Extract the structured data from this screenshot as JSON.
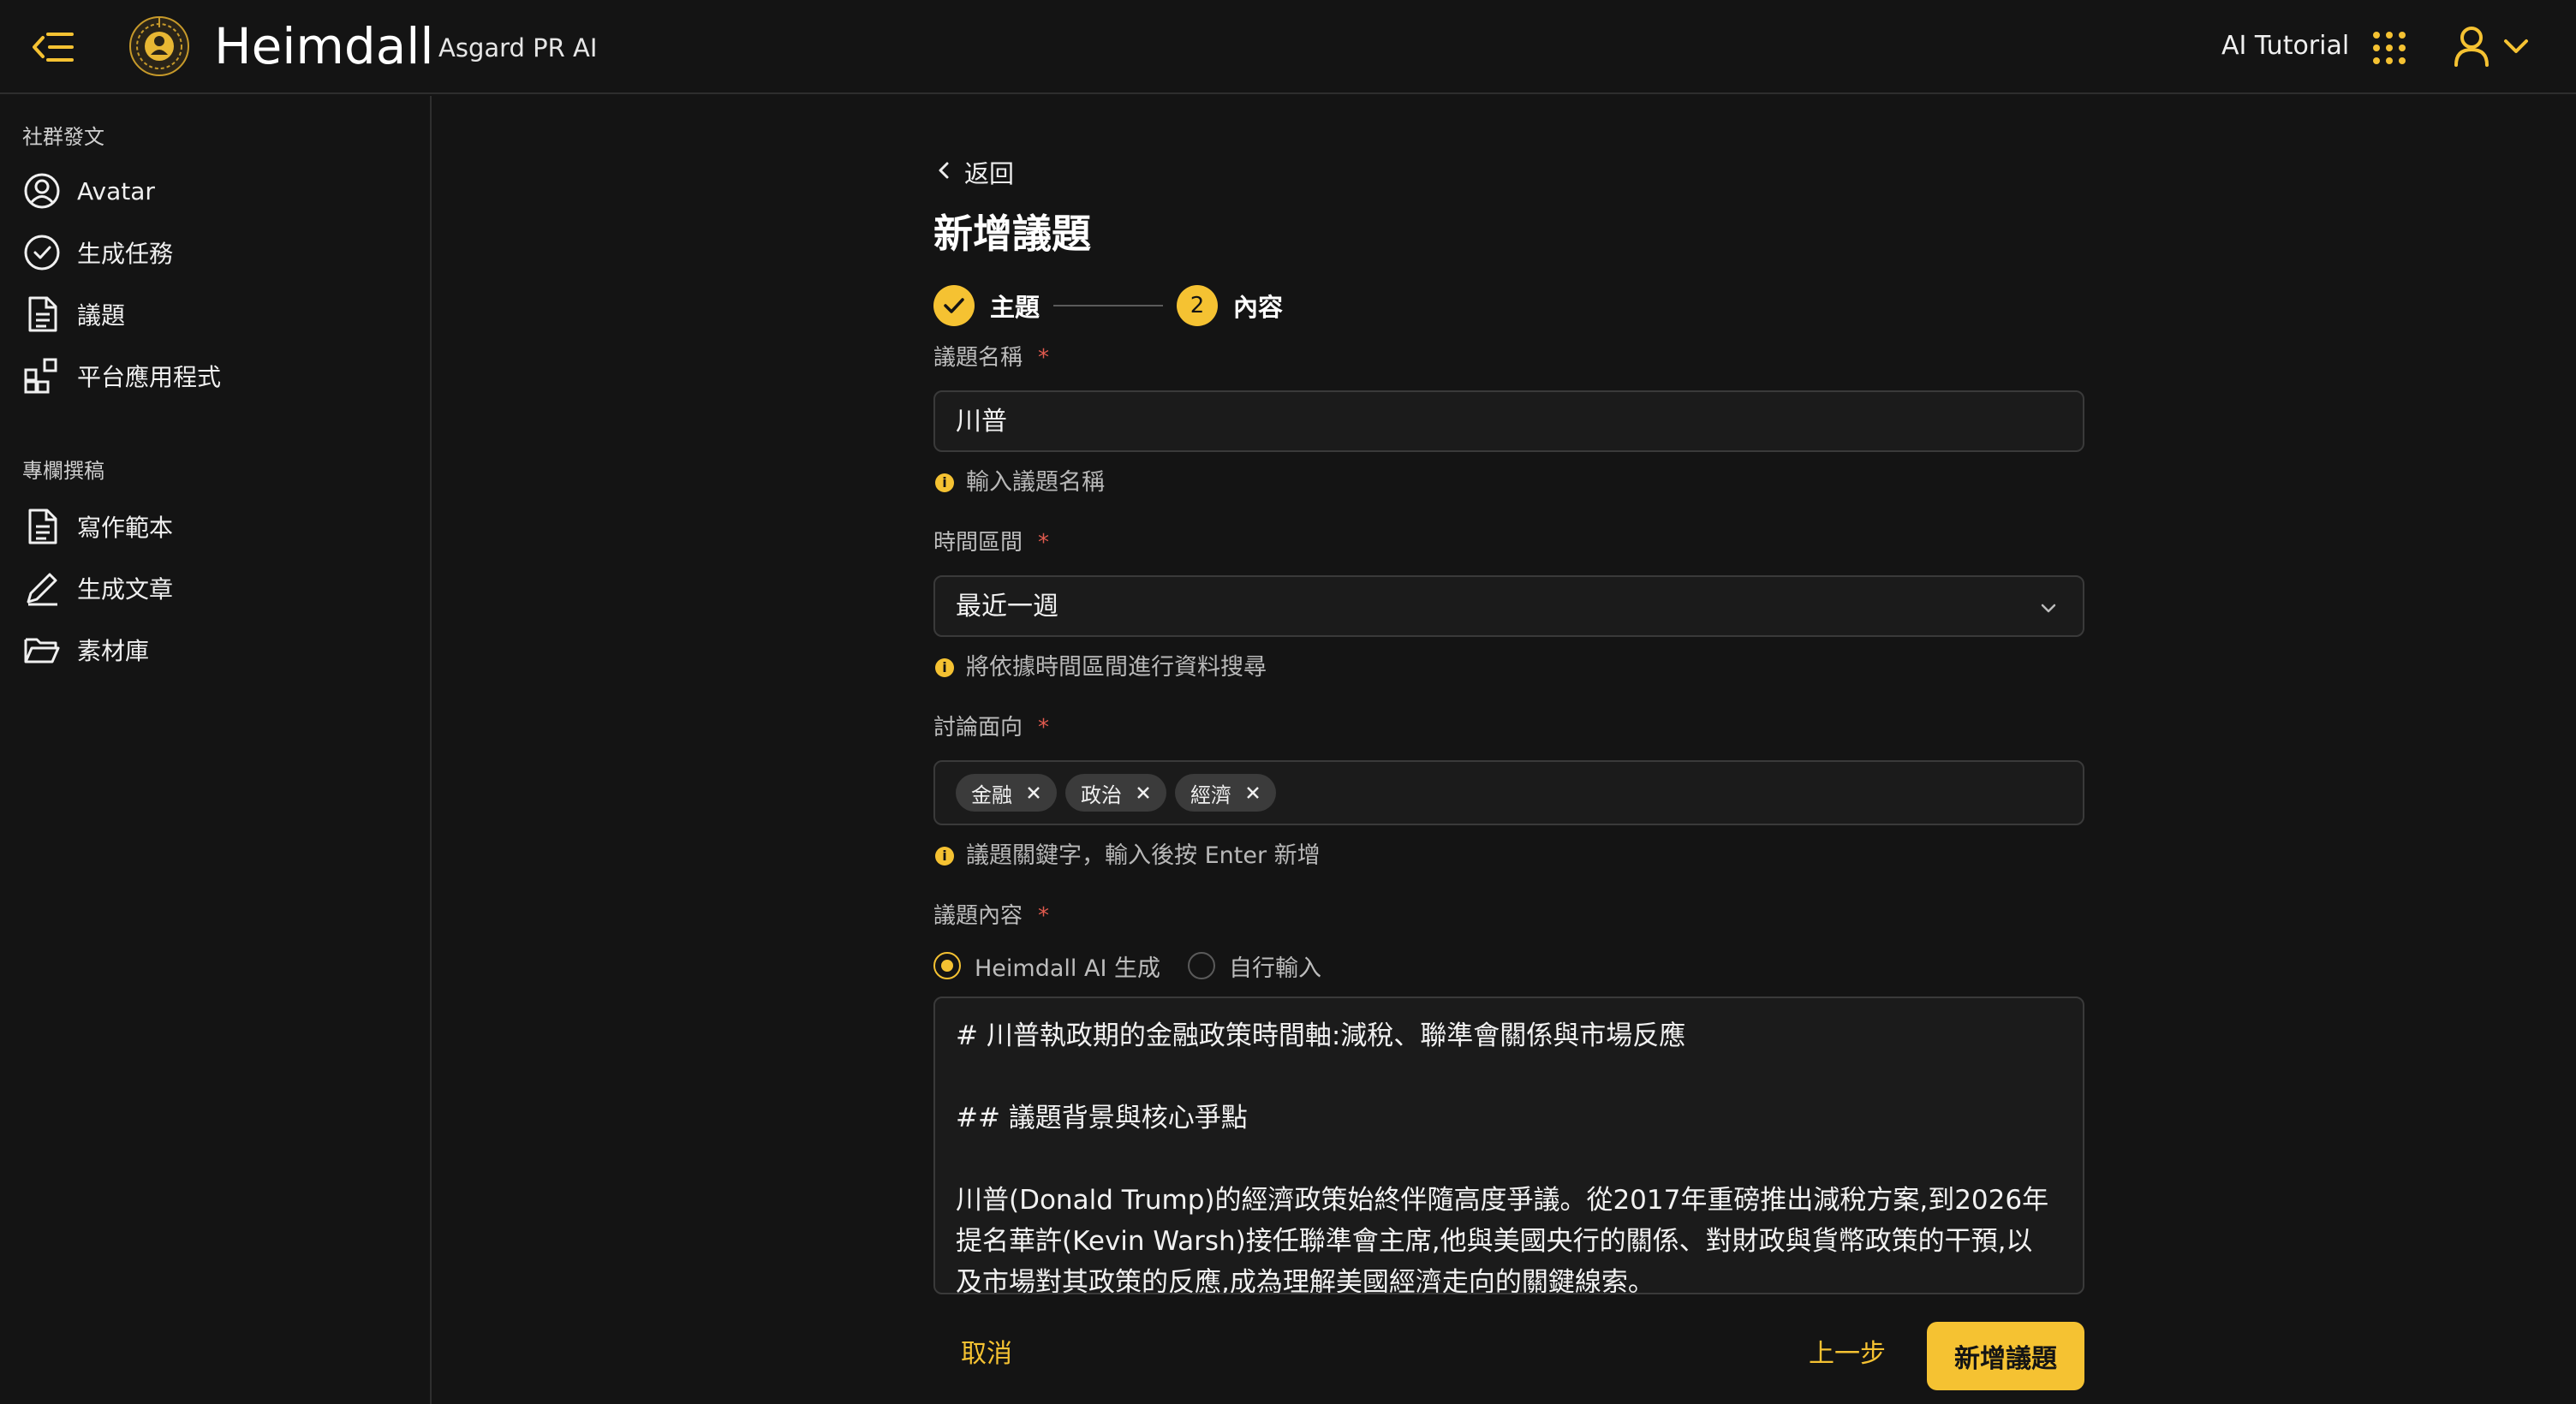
{
  "header": {
    "brand": "Heimdall",
    "brand_sub": "Asgard PR AI",
    "tutorial_label": "AI Tutorial"
  },
  "sidebar": {
    "section_social": "社群發文",
    "social_items": [
      {
        "label": "Avatar",
        "icon": "avatar-icon"
      },
      {
        "label": "生成任務",
        "icon": "check-circle-icon"
      },
      {
        "label": "議題",
        "icon": "document-icon"
      },
      {
        "label": "平台應用程式",
        "icon": "apps-grid-icon"
      }
    ],
    "section_column": "專欄撰稿",
    "column_items": [
      {
        "label": "寫作範本",
        "icon": "document-icon"
      },
      {
        "label": "生成文章",
        "icon": "pen-icon"
      },
      {
        "label": "素材庫",
        "icon": "folder-icon"
      }
    ]
  },
  "form": {
    "back_label": "返回",
    "title": "新增議題",
    "steps": [
      {
        "label": "主題",
        "state": "done"
      },
      {
        "number": "2",
        "label": "內容",
        "state": "current"
      }
    ],
    "topic_name": {
      "label": "議題名稱",
      "required_mark": "*",
      "value": "川普",
      "hint": "輸入議題名稱"
    },
    "time_range": {
      "label": "時間區間",
      "required_mark": "*",
      "value": "最近一週",
      "hint": "將依據時間區間進行資料搜尋"
    },
    "aspects": {
      "label": "討論面向",
      "required_mark": "*",
      "tags": [
        "金融",
        "政治",
        "經濟"
      ],
      "hint": "議題關鍵字，輸入後按 Enter 新增"
    },
    "content": {
      "label": "議題內容",
      "required_mark": "*",
      "options": [
        {
          "label": "Heimdall AI 生成",
          "selected": true
        },
        {
          "label": "自行輸入",
          "selected": false
        }
      ],
      "text": "# 川普執政期的金融政策時間軸:減稅、聯準會關係與市場反應\n\n## 議題背景與核心爭點\n\n川普(Donald Trump)的經濟政策始終伴隨高度爭議。從2017年重磅推出減稅方案,到2026年\n提名華許(Kevin Warsh)接任聯準會主席,他與美國央行的關係、對財政與貨幣政策的干預,以\n及市場對其政策的反應,成為理解美國經濟走向的關鍵線索。"
    },
    "cancel_label": "取消",
    "prev_label": "上一步",
    "submit_label": "新增議題"
  },
  "colors": {
    "accent": "#f5c232",
    "background": "#141414",
    "required": "#e05a4e"
  }
}
